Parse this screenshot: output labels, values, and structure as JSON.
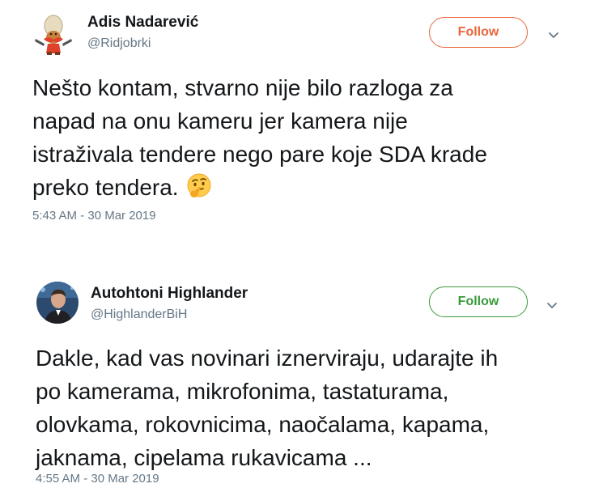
{
  "tweets": [
    {
      "author_name": "Adis Nadarević",
      "handle": "@Ridjobrki",
      "follow_label": "Follow",
      "follow_color": "#e8663a",
      "avatar": "cartoon-cowboy-icon",
      "text_lines": [
        "Nešto kontam, stvarno nije bilo razloga za",
        "napad na onu kameru jer kamera nije",
        "istraživala tendere nego pare koje SDA krade",
        "preko tendera."
      ],
      "emoji": "thinking-face-icon",
      "timestamp": "5:43 AM - 30 Mar 2019"
    },
    {
      "author_name": "Autohtoni Highlander",
      "handle": "@HighlanderBiH",
      "follow_label": "Follow",
      "follow_color": "#3a9a3a",
      "avatar": "person-photo-avatar",
      "text_lines": [
        "Dakle, kad vas novinari iznerviraju, udarajte ih",
        "po kamerama, mikrofonima, tastaturama,",
        "olovkama, rokovnicima, naočalama, kapama,",
        "jaknama, cipelama rukavicama ..."
      ],
      "timestamp": "4:55 AM - 30 Mar 2019"
    }
  ]
}
